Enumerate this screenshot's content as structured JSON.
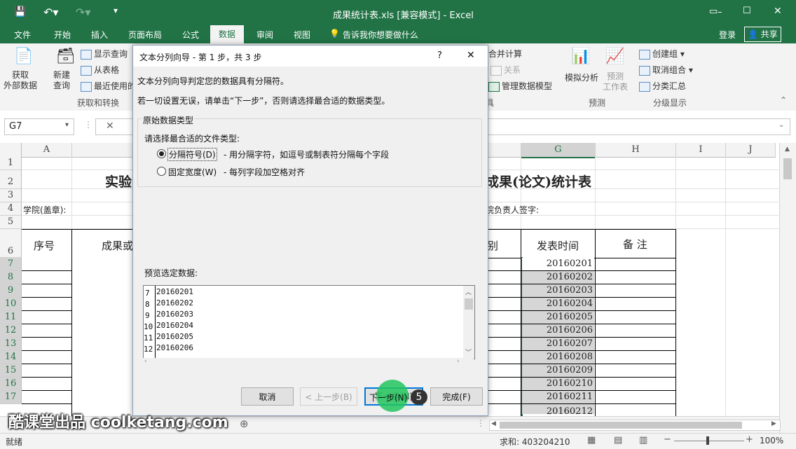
{
  "window": {
    "title": "成果统计表.xls  [兼容模式] - Excel"
  },
  "tabs": [
    "文件",
    "开始",
    "插入",
    "页面布局",
    "公式",
    "数据",
    "审阅",
    "视图"
  ],
  "tell_me": "告诉我你想要做什么",
  "login": "登录",
  "share": "共享",
  "ribbon": {
    "get_external": "获取\n外部数据",
    "new_query": "新建\n查询",
    "show_query": "显示查询",
    "from_table": "从表格",
    "recent_sources": "最近使用的",
    "group_get_transform": "获取和转换",
    "merge_calc": "合并计算",
    "relations": "关系",
    "manage_model": "管理数据模型",
    "what_if": "模拟分析",
    "forecast_sheet": "预测\n工作表",
    "group_forecast": "预测",
    "group_btn": "创建组",
    "ungroup_btn": "取消组合",
    "subtotal_btn": "分类汇总",
    "group_outline": "分级显示",
    "fragment_ji": "具"
  },
  "namebox": "G7",
  "columns": [
    "A",
    "G",
    "H",
    "I",
    "J"
  ],
  "rows": [
    "1",
    "2",
    "3",
    "4",
    "5",
    "6",
    "7",
    "8",
    "9",
    "10",
    "11",
    "12",
    "13",
    "14",
    "15",
    "16",
    "17"
  ],
  "sheet": {
    "title_left": "实验",
    "title_right": "成果(论文)统计表",
    "college": "学院(盖章):",
    "leader": "院负责人签字:",
    "hdr_seq": "序号",
    "hdr_result": "成果或",
    "hdr_type": "别",
    "hdr_date": "发表时间",
    "hdr_note": "备 注",
    "g_values": [
      "20160201",
      "20160202",
      "20160203",
      "20160204",
      "20160205",
      "20160206",
      "20160207",
      "20160208",
      "20160209",
      "20160210",
      "20160211",
      "20160212"
    ]
  },
  "dialog": {
    "title": "文本分列向导 - 第 1 步，共 3 步",
    "help": "?",
    "close": "✕",
    "line1": "文本分列向导判定您的数据具有分隔符。",
    "line2": "若一切设置无误，请单击“下一步”，否则请选择最合适的数据类型。",
    "group_title": "原始数据类型",
    "choose_label": "请选择最合适的文件类型:",
    "opt1_label": "分隔符号(D)",
    "opt1_desc": "- 用分隔字符，如逗号或制表符分隔每个字段",
    "opt2_label": "固定宽度(W)",
    "opt2_desc": "- 每列字段加空格对齐",
    "preview_label": "预览选定数据:",
    "preview_rows": [
      {
        "n": "7",
        "v": "20160201"
      },
      {
        "n": "8",
        "v": "20160202"
      },
      {
        "n": "9",
        "v": "20160203"
      },
      {
        "n": "10",
        "v": "20160204"
      },
      {
        "n": "11",
        "v": "20160205"
      },
      {
        "n": "12",
        "v": "20160206"
      }
    ],
    "btn_cancel": "取消",
    "btn_prev": "< 上一步(B)",
    "btn_next": "下一步(N)",
    "btn_finish": "完成(F)",
    "step_badge": "5"
  },
  "status": {
    "ready": "就绪",
    "sum": "求和: 403204210",
    "zoom": "100%"
  },
  "watermark": "酷课堂出品 coolketang.com",
  "colors": {
    "excel_green": "#217346",
    "accent_circle": "#22c55e"
  }
}
